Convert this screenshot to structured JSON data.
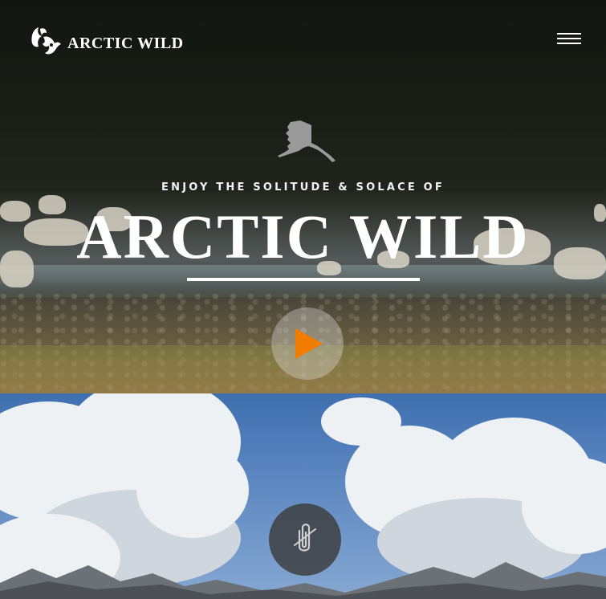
{
  "header": {
    "logo_text": "ARCTIC WILD",
    "logo_icon": "caribou-antler-logo-icon",
    "menu_icon": "hamburger-menu-icon"
  },
  "hero": {
    "map_icon": "alaska-map-icon",
    "tagline": "ENJOY THE SOLITUDE & SOLACE OF",
    "title": "ARCTIC WILD",
    "play_icon": "play-icon",
    "play_color": "#f07d00"
  },
  "section2": {
    "feature_icon": "paperclip-badge-icon"
  }
}
